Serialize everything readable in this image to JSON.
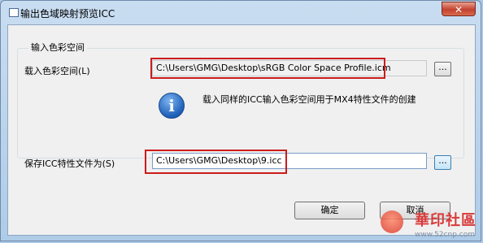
{
  "window": {
    "title": "输出色域映射预览ICC",
    "close_glyph": "✕"
  },
  "input_group": {
    "label": "输入色彩空间",
    "load_label": "载入色彩空间(L)",
    "load_path": "C:\\Users\\GMG\\Desktop\\sRGB Color Space Profile.icm",
    "browse_label": "...",
    "info_icon_glyph": "i",
    "info_text": "载入同样的ICC输入色彩空间用于MX4特性文件的创建"
  },
  "save": {
    "label": "保存ICC特性文件为(S)",
    "path": "C:\\Users\\GMG\\Desktop\\9.icc",
    "browse_label": "..."
  },
  "buttons": {
    "ok": "确定",
    "cancel": "取消"
  },
  "watermark": {
    "text": "華印社區",
    "url": "www.52cnp.com"
  },
  "colors": {
    "highlight_box": "#cc1b1b",
    "info_icon": "#1d5fb8"
  }
}
